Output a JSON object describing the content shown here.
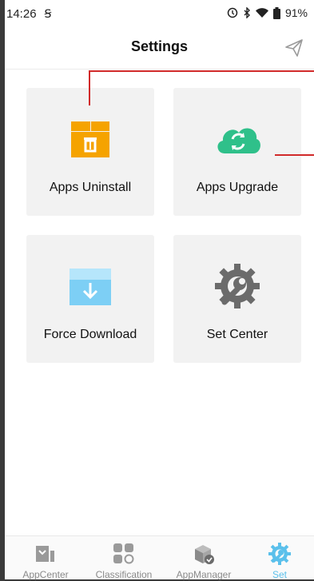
{
  "status_bar": {
    "time": "14:26",
    "sim_glyph": "Ꞩ",
    "battery": "91%"
  },
  "header": {
    "title": "Settings",
    "action_icon": "send-icon"
  },
  "tiles": [
    {
      "label": "Apps Uninstall",
      "icon": "box-trash-icon",
      "color": "#f5a300"
    },
    {
      "label": "Apps Upgrade",
      "icon": "cloud-sync-icon",
      "color": "#2fc08a"
    },
    {
      "label": "Force Download",
      "icon": "box-download-icon",
      "color": "#7dcff5"
    },
    {
      "label": "Set Center",
      "icon": "gear-wrench-icon",
      "color": "#6b6b6b"
    }
  ],
  "bottom_nav": [
    {
      "label": "AppCenter",
      "icon": "appcenter-icon"
    },
    {
      "label": "Classification",
      "icon": "grid-icon"
    },
    {
      "label": "AppManager",
      "icon": "box-check-icon"
    },
    {
      "label": "Set",
      "icon": "gear-wrench-icon",
      "active": true
    }
  ],
  "colors": {
    "accent": "#5bc0eb",
    "annotation": "#d12a2a",
    "tile_bg": "#f2f2f2"
  }
}
